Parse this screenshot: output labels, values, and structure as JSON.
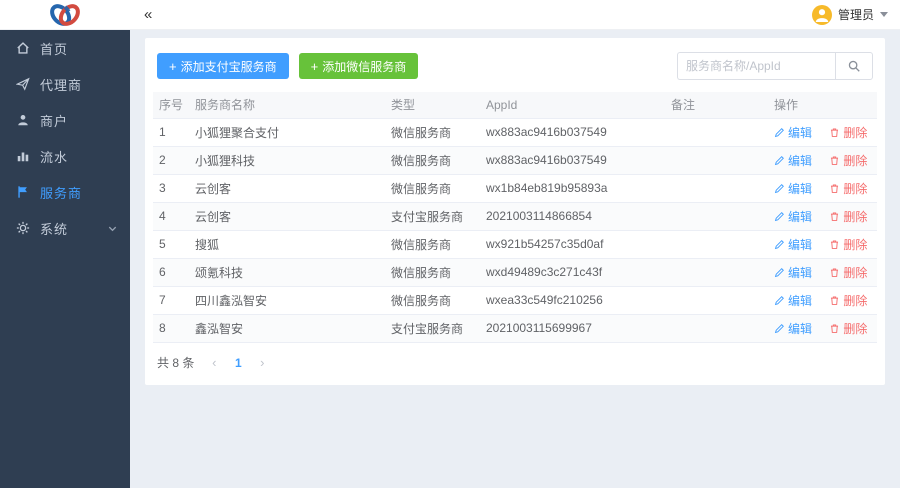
{
  "topbar": {
    "collapse_glyph": "«",
    "user_name": "管理员"
  },
  "sidebar": {
    "items": [
      {
        "label": "首页",
        "icon": "home-icon",
        "active": false
      },
      {
        "label": "代理商",
        "icon": "send-icon",
        "active": false
      },
      {
        "label": "商户",
        "icon": "user-icon",
        "active": false
      },
      {
        "label": "流水",
        "icon": "chart-icon",
        "active": false
      },
      {
        "label": "服务商",
        "icon": "flag-icon",
        "active": true
      },
      {
        "label": "系统",
        "icon": "gear-icon",
        "active": false
      }
    ]
  },
  "toolbar": {
    "plus_glyph": "+",
    "add_alipay_label": "添加支付宝服务商",
    "add_wechat_label": "添加微信服务商",
    "search_placeholder": "服务商名称/AppId"
  },
  "table": {
    "headers": [
      "序号",
      "服务商名称",
      "类型",
      "AppId",
      "备注",
      "操作"
    ],
    "edit_label": "编辑",
    "delete_label": "删除",
    "rows": [
      {
        "no": "1",
        "name": "小狐狸聚合支付",
        "type": "微信服务商",
        "appid": "wx883ac9416b037549",
        "remark": ""
      },
      {
        "no": "2",
        "name": "小狐狸科技",
        "type": "微信服务商",
        "appid": "wx883ac9416b037549",
        "remark": ""
      },
      {
        "no": "3",
        "name": "云创客",
        "type": "微信服务商",
        "appid": "wx1b84eb819b95893a",
        "remark": ""
      },
      {
        "no": "4",
        "name": "云创客",
        "type": "支付宝服务商",
        "appid": "2021003114866854",
        "remark": ""
      },
      {
        "no": "5",
        "name": "搜狐",
        "type": "微信服务商",
        "appid": "wx921b54257c35d0af",
        "remark": ""
      },
      {
        "no": "6",
        "name": "颂氪科技",
        "type": "微信服务商",
        "appid": "wxd49489c3c271c43f",
        "remark": ""
      },
      {
        "no": "7",
        "name": "四川鑫泓智安",
        "type": "微信服务商",
        "appid": "wxea33c549fc210256",
        "remark": ""
      },
      {
        "no": "8",
        "name": "鑫泓智安",
        "type": "支付宝服务商",
        "appid": "2021003115699967",
        "remark": ""
      }
    ]
  },
  "pagination": {
    "total_label": "共 8 条",
    "prev_glyph": "‹",
    "page": "1",
    "next_glyph": "›"
  },
  "colors": {
    "accent": "#409eff",
    "success": "#67c23a",
    "danger": "#f56c6c",
    "sidebar_bg": "#2f3e52",
    "avatar_bg": "#f7ba2a",
    "logo_blue": "#2566ad",
    "logo_red": "#d24b40"
  }
}
